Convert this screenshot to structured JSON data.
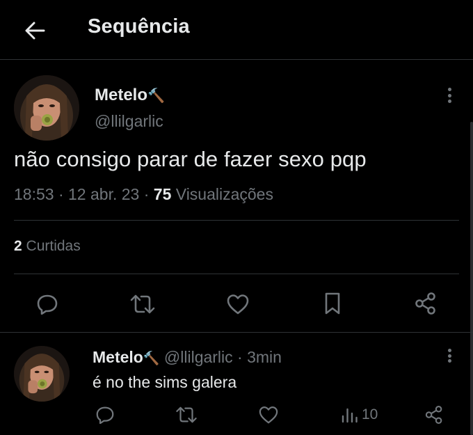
{
  "header": {
    "title": "Sequência",
    "back_icon": "arrow-left-icon"
  },
  "main_tweet": {
    "display_name": "Metelo",
    "name_emoji": "🔨",
    "handle": "@llilgarlic",
    "text": "não consigo parar de fazer sexo pqp",
    "time": "18:53",
    "date": "12 abr. 23",
    "views_count": "75",
    "views_label": "Visualizações",
    "likes_count": "2",
    "likes_label": "Curtidas",
    "actions": [
      "reply-icon",
      "retweet-icon",
      "like-icon",
      "bookmark-icon",
      "share-icon"
    ]
  },
  "reply_tweet": {
    "display_name": "Metelo",
    "name_emoji": "🔨",
    "handle": "@llilgarlic",
    "separator": "·",
    "time_ago": "3min",
    "text": "é no the sims galera",
    "views_count": "10",
    "actions": [
      "reply-icon",
      "retweet-icon",
      "like-icon",
      "views-icon",
      "share-icon"
    ]
  },
  "colors": {
    "background": "#000000",
    "text_primary": "#e7e9ea",
    "text_secondary": "#71767b",
    "divider": "#2f3336"
  }
}
